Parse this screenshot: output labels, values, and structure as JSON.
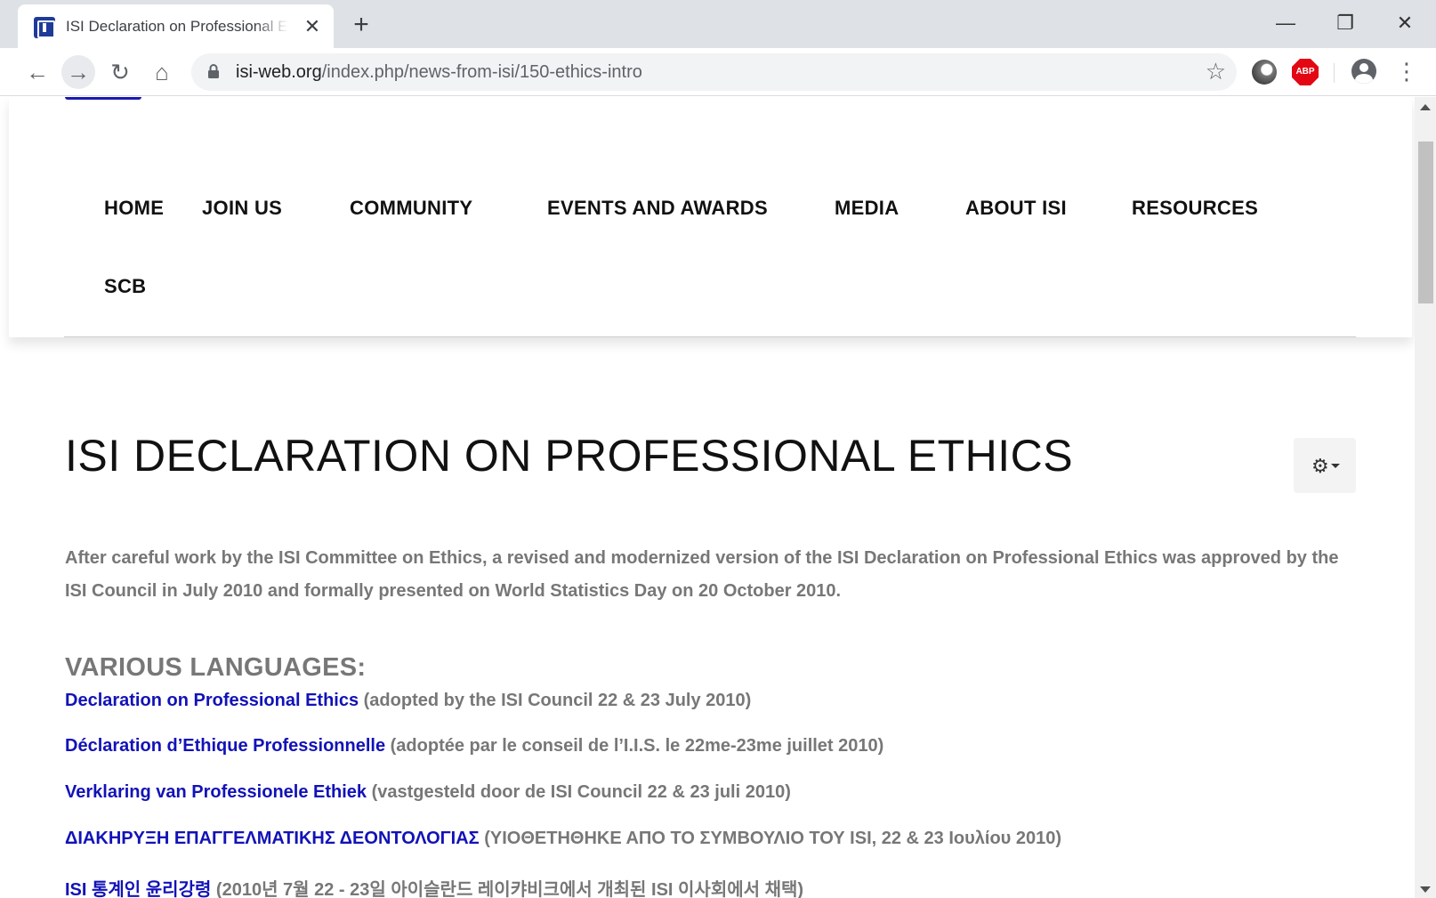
{
  "browser": {
    "tab_title": "ISI Declaration on Professional Ethics",
    "url_host": "isi-web.org",
    "url_path": "/index.php/news-from-isi/150-ethics-intro",
    "new_tab_label": "+",
    "close_tab_label": "✕"
  },
  "nav": {
    "items": [
      {
        "label": "HOME"
      },
      {
        "label": "JOIN US"
      },
      {
        "label": "COMMUNITY"
      },
      {
        "label": "EVENTS AND AWARDS"
      },
      {
        "label": "MEDIA"
      },
      {
        "label": "ABOUT ISI"
      },
      {
        "label": "RESOURCES"
      },
      {
        "label": "SCB"
      }
    ]
  },
  "article": {
    "title": "ISI DECLARATION ON PROFESSIONAL ETHICS",
    "intro": "After careful work by the ISI Committee on Ethics, a revised and modernized version of the ISI Declaration on Professional Ethics was approved by the ISI Council in July 2010 and formally presented on World Statistics Day on 20 October 2010.",
    "section_heading": "VARIOUS LANGUAGES:",
    "languages": [
      {
        "link": "Declaration on Professional Ethics",
        "note": " (adopted by the ISI Council 22 & 23 July 2010)"
      },
      {
        "link": "Déclaration d’Ethique Professionnelle",
        "note": " (adoptée par le conseil de l’I.I.S. le 22me-23me juillet 2010)"
      },
      {
        "link": "Verklaring van Professionele Ethiek",
        "note": " (vastgesteld door de ISI Council 22 & 23 juli 2010)"
      },
      {
        "link": "ΔΙΑΚΗΡΥΞΗ ΕΠΑΓΓΕΛΜΑΤΙΚΗΣ ΔΕΟΝΤΟΛΟΓΙΑΣ",
        "note": " (ΥΙΟΘΕΤΗΘΗΚΕ ΑΠΟ ΤΟ ΣΥΜΒΟΥΛΙΟ ΤΟΥ ISI, 22 & 23 Ιουλίου 2010)"
      },
      {
        "link": "ISI 통계인 윤리강령",
        "note": " (2010년 7월 22 - 23일 아이슬란드 레이캬비크에서 개최된 ISI 이사회에서 채택)"
      }
    ]
  },
  "icons": {
    "tools": "gear-icon",
    "bookmark": "star-icon",
    "secure": "lock-icon"
  },
  "colors": {
    "link": "#1212b8",
    "muted_text": "#777777",
    "brand": "#1f3b99"
  }
}
